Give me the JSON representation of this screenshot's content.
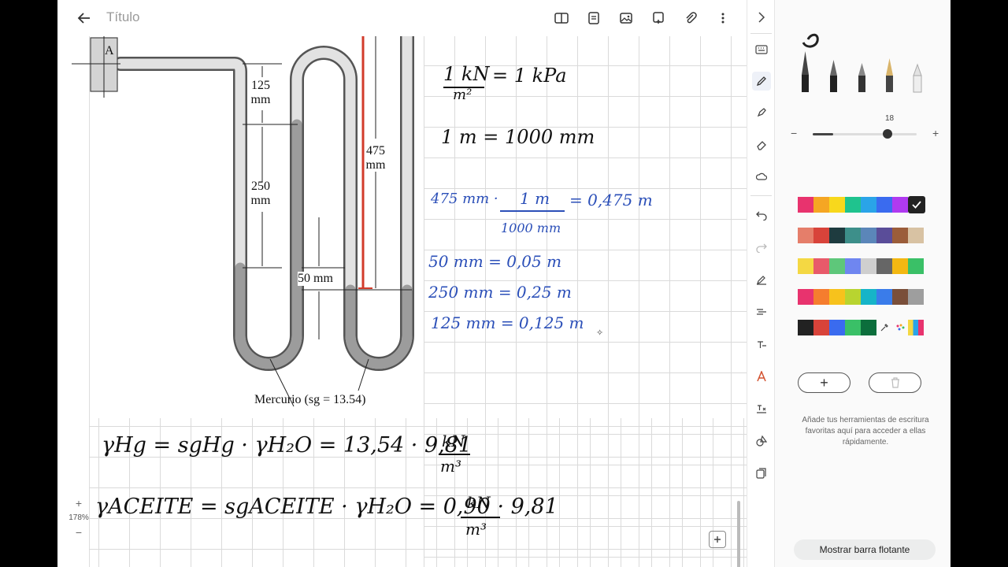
{
  "header": {
    "title": "Título"
  },
  "diagram": {
    "point_label": "A",
    "dim_125": [
      "125",
      "mm"
    ],
    "dim_250": [
      "250",
      "mm"
    ],
    "dim_475": [
      "475",
      "mm"
    ],
    "dim_50": "50 mm",
    "fluid_label": "Mercurio (sg = 13.54)"
  },
  "notes": {
    "line1_num": "1 kN",
    "line1_den": "m²",
    "line1_rhs": "= 1 kPa",
    "line2": "1 m = 1000 mm",
    "conv_lhs": "475 mm ·",
    "conv_num": "1 m",
    "conv_den": "1000 mm",
    "conv_rhs": "= 0,475 m",
    "conv2": "50 mm = 0,05 m",
    "conv3": "250 mm = 0,25 m",
    "conv4": "125 mm = 0,125 m",
    "eq1_lhs": "γHg = sgHg · γH₂O = 13,54 · 9,81",
    "eq1_num": "kN",
    "eq1_den": "m³",
    "eq2_lhs": "γACEITE = sgACEITE · γH₂O = 0,90 · 9,81",
    "eq2_num": "kN",
    "eq2_den": "m³"
  },
  "zoom": {
    "plus": "+",
    "level": "178%",
    "minus": "−"
  },
  "panel": {
    "thickness_value": "18",
    "minus": "−",
    "plus": "+",
    "add_label": "+",
    "hint": "Añade tus herramientas de escritura favoritas aquí para acceder a ellas rápidamente.",
    "float_button": "Mostrar barra flotante",
    "palette": [
      [
        "#e8336e",
        "#f5a623",
        "#f8d81c",
        "#1fc38e",
        "#2aa4e8",
        "#3a6bef",
        "#b03af0",
        "#222222"
      ],
      [
        "#e57e6a",
        "#d8433a",
        "#1e3b3f",
        "#3d8f8a",
        "#5b86b9",
        "#5a4d99",
        "#9b5d3a",
        "#d8c2a3"
      ],
      [
        "#f4d843",
        "#e85a6a",
        "#5ec77a",
        "#6f86f0",
        "#cfcfcf",
        "#666666",
        "#f3b812",
        "#3ac067"
      ],
      [
        "#e8336e",
        "#f57d2e",
        "#f7c21c",
        "#b8d430",
        "#16b4c8",
        "#3a7cea",
        "#7a4f3a",
        "#9e9e9e"
      ],
      [
        "#222222",
        "#d8433a",
        "#3a6bef",
        "#3ac067",
        "#0c6e3c"
      ]
    ]
  }
}
